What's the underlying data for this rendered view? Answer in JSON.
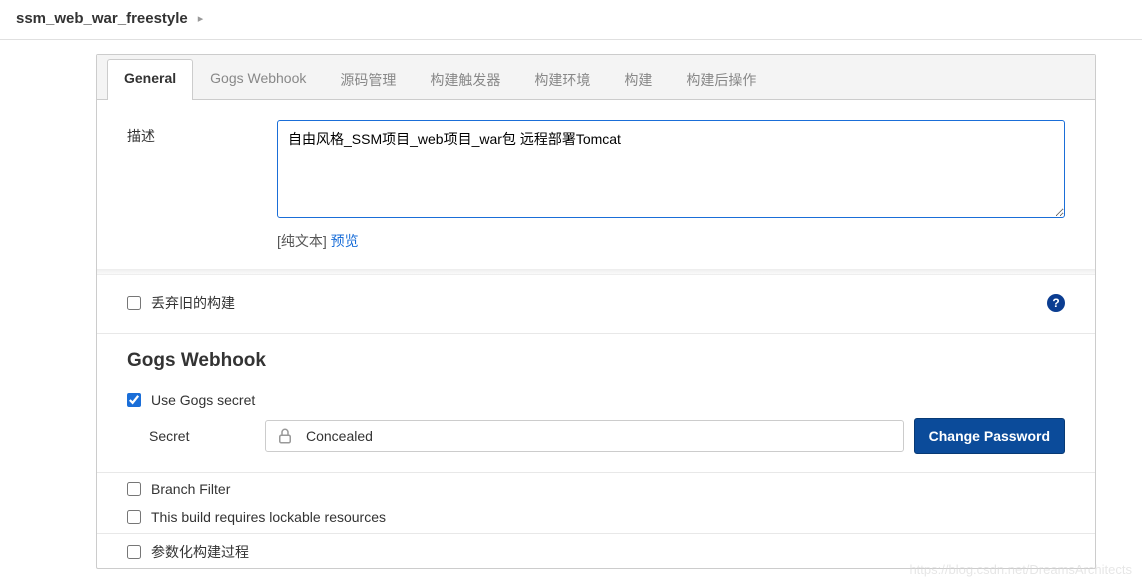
{
  "breadcrumb": {
    "title": "ssm_web_war_freestyle"
  },
  "tabs": [
    {
      "label": "General",
      "active": true
    },
    {
      "label": "Gogs Webhook",
      "active": false
    },
    {
      "label": "源码管理",
      "active": false
    },
    {
      "label": "构建触发器",
      "active": false
    },
    {
      "label": "构建环境",
      "active": false
    },
    {
      "label": "构建",
      "active": false
    },
    {
      "label": "构建后操作",
      "active": false
    }
  ],
  "description": {
    "label": "描述",
    "value": "自由风格_SSM项目_web项目_war包 远程部署Tomcat",
    "plain_text_label": "[纯文本]",
    "preview_label": "预览"
  },
  "discard_old": {
    "label": "丢弃旧的构建",
    "checked": false
  },
  "gogs": {
    "section_title": "Gogs Webhook",
    "use_secret": {
      "label": "Use Gogs secret",
      "checked": true
    },
    "secret_label": "Secret",
    "concealed_text": "Concealed",
    "change_password_label": "Change Password"
  },
  "branch_filter": {
    "label": "Branch Filter",
    "checked": false
  },
  "lockable": {
    "label": "This build requires lockable resources",
    "checked": false
  },
  "parameterized": {
    "label": "参数化构建过程",
    "checked": false
  },
  "help_tooltip": "?",
  "watermark": "https://blog.csdn.net/DreamsArchitects"
}
